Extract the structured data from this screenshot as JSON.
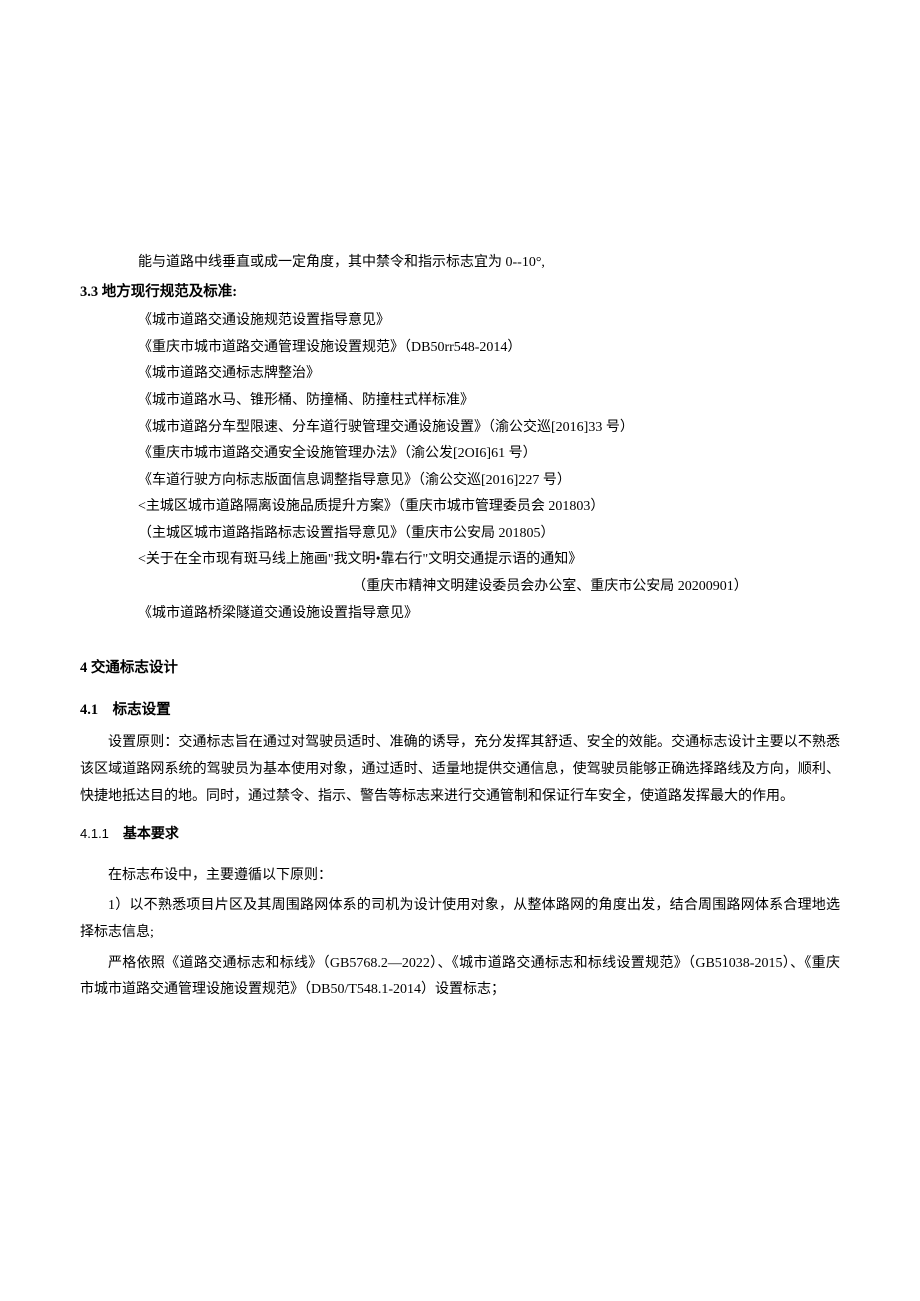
{
  "intro_line": "能与道路中线垂直或成一定角度，其中禁令和指示标志宜为 0--10°,",
  "h33": "3.3 地方现行规范及标准:",
  "refs": [
    "《城市道路交通设施规范设置指导意见》",
    "《重庆市城市道路交通管理设施设置规范》（DB50rr548-2014）",
    "《城市道路交通标志牌整治》",
    "《城市道路水马、锥形桶、防撞桶、防撞柱式样标准》",
    "《城市道路分车型限速、分车道行驶管理交通设施设置》（渝公交巡[2016]33 号）",
    "《重庆市城市道路交通安全设施管理办法》（渝公发[2OI6]61 号）",
    "《车道行驶方向标志版面信息调整指导意见》（渝公交巡[2016]227 号）",
    "<主城区城市道路隔离设施品质提升方案》（重庆市城市管理委员会 201803）",
    "（主城区城市道路指路标志设置指导意见》（重庆市公安局 201805）",
    "<关于在全市现有斑马线上施画\"我文明•靠右行\"文明交通提示语的通知》"
  ],
  "ref_source": "（重庆市精神文明建设委员会办公室、重庆市公安局 20200901）",
  "ref_last": "《城市道路桥梁隧道交通设施设置指导意见》",
  "h4": "4 交通标志设计",
  "h41": "4.1　标志设置",
  "p41": "设置原则：交通标志旨在通过对驾驶员适时、准确的诱导，充分发挥其舒适、安全的效能。交通标志设计主要以不熟悉该区域道路网系统的驾驶员为基本使用对象，通过适时、适量地提供交通信息，使驾驶员能够正确选择路线及方向，顺利、快捷地抵达目的地。同时，通过禁令、指示、警告等标志来进行交通管制和保证行车安全，使道路发挥最大的作用。",
  "h411_num": "4.1.1",
  "h411_txt": "基本要求",
  "p411a": "在标志布设中，主要遵循以下原则：",
  "p411b": "1）以不熟悉项目片区及其周围路网体系的司机为设计使用对象，从整体路网的角度出发，结合周围路网体系合理地选择标志信息;",
  "p411c": "严格依照《道路交通标志和标线》（GB5768.2—2022）、《城市道路交通标志和标线设置规范》（GB51038-2015）、《重庆市城市道路交通管理设施设置规范》（DB50/T548.1-2014）设置标志；"
}
